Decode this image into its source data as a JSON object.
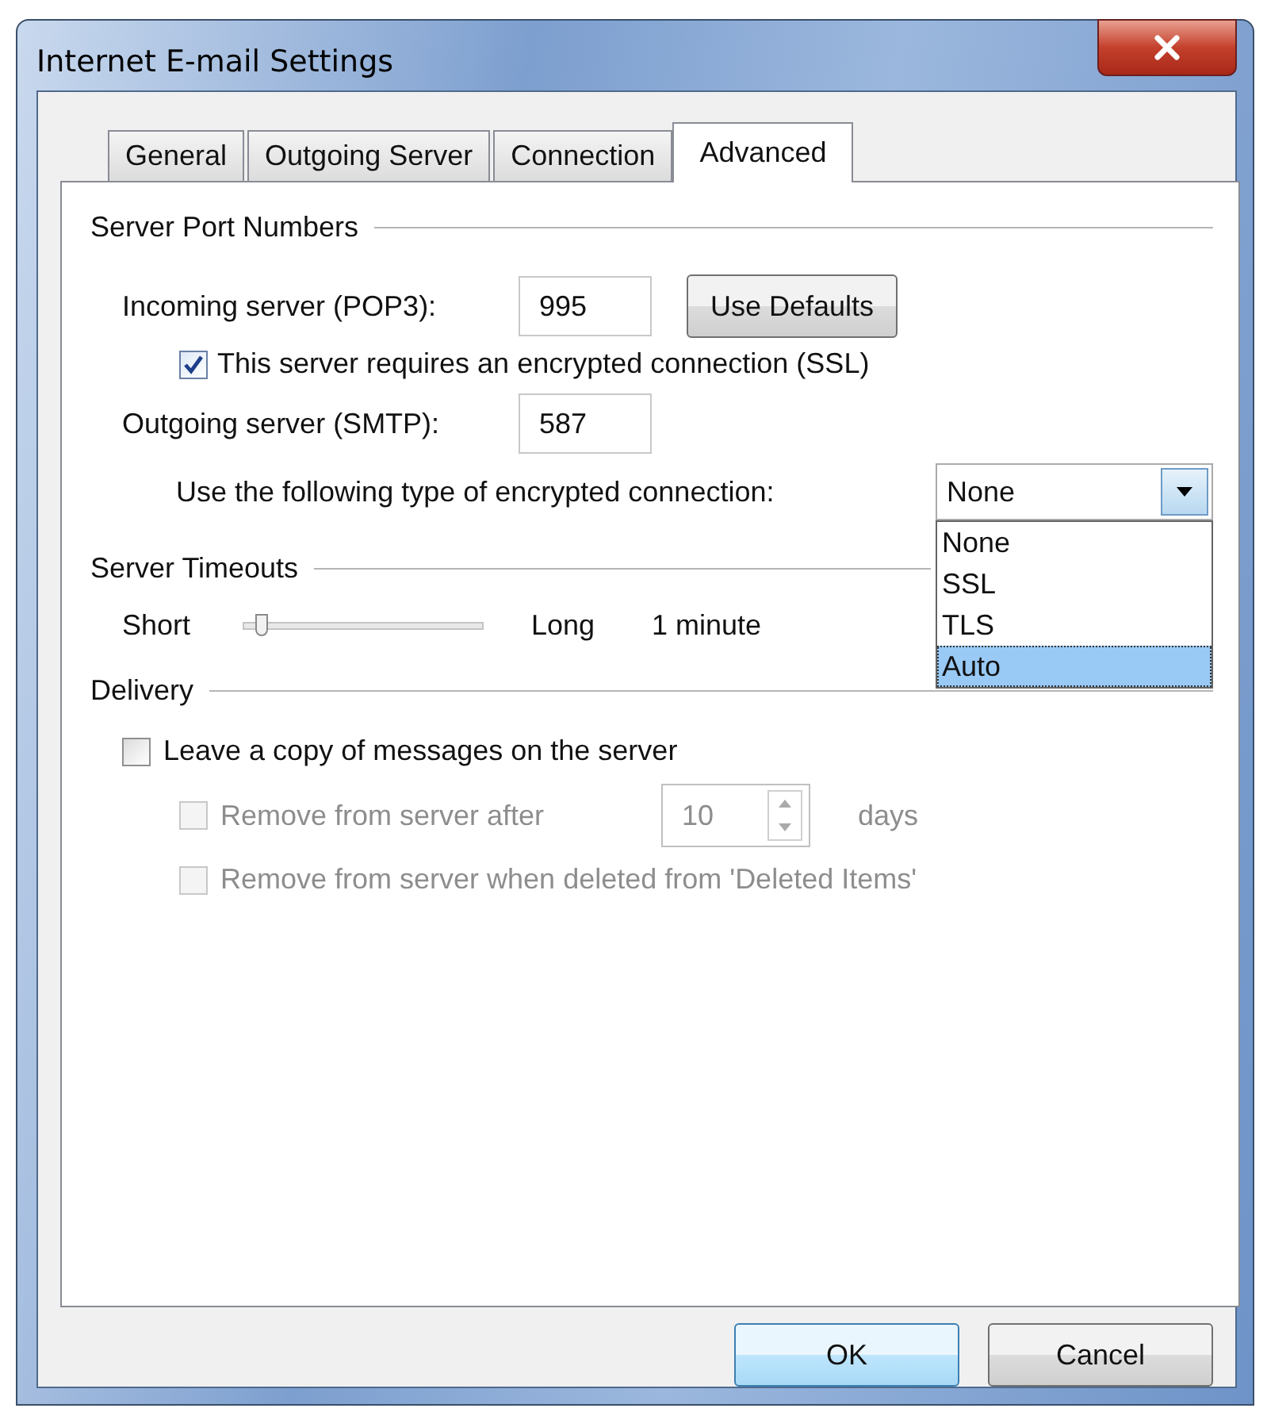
{
  "window": {
    "title": "Internet E-mail Settings"
  },
  "tabs": [
    {
      "label": "General",
      "selected": false
    },
    {
      "label": "Outgoing Server",
      "selected": false
    },
    {
      "label": "Connection",
      "selected": false
    },
    {
      "label": "Advanced",
      "selected": true
    }
  ],
  "port_numbers": {
    "title": "Server Port Numbers",
    "incoming": {
      "label": "Incoming server (POP3):",
      "value": "995",
      "button": "Use Defaults"
    },
    "ssl": {
      "label": "This server requires an encrypted connection (SSL)",
      "checked": true
    },
    "outgoing": {
      "label": "Outgoing server (SMTP):",
      "value": "587"
    },
    "encryption": {
      "label": "Use the following type of encrypted connection:",
      "value": "None",
      "expanded": true,
      "options": [
        {
          "label": "None",
          "highlighted": false
        },
        {
          "label": "SSL",
          "highlighted": false
        },
        {
          "label": "TLS",
          "highlighted": false
        },
        {
          "label": "Auto",
          "highlighted": true
        }
      ]
    }
  },
  "timeouts": {
    "title": "Server Timeouts",
    "min_label": "Short",
    "level": 0.07,
    "max_label": "Long",
    "reading": "1 minute"
  },
  "delivery": {
    "title": "Delivery",
    "leave_copy": {
      "label": "Leave a copy of messages on the server",
      "checked": false,
      "disabled": false
    },
    "remove_after": {
      "label": "Remove from server after",
      "checked": false,
      "disabled": true,
      "value": "10",
      "unit": "days"
    },
    "remove_deleted": {
      "label": "Remove from server when deleted from 'Deleted Items'",
      "checked": false,
      "disabled": true
    }
  },
  "buttons": [
    {
      "label": "OK",
      "default": true
    },
    {
      "label": "Cancel",
      "default": false
    }
  ]
}
